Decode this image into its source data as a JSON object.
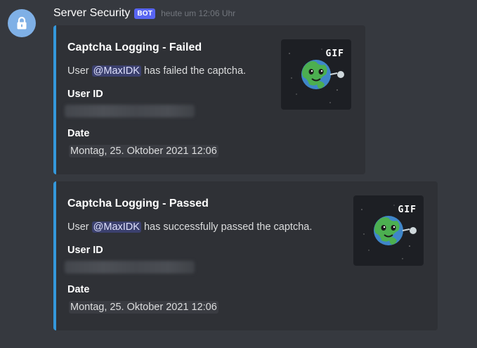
{
  "message": {
    "avatar_icon": "lock-icon",
    "username": "Server Security",
    "bot_tag": "BOT",
    "timestamp": "heute um 12:06 Uhr"
  },
  "embeds": [
    {
      "title": "Captcha Logging - Failed",
      "desc_prefix": "User ",
      "mention": "@MaxIDK",
      "desc_suffix": " has failed the captcha.",
      "fields": [
        {
          "name": "User ID",
          "value_redacted": true
        },
        {
          "name": "Date",
          "value": "Montag, 25. Oktober 2021 12:06"
        }
      ],
      "thumbnail_badge": "GIF",
      "accent_color": "#3498db"
    },
    {
      "title": "Captcha Logging - Passed",
      "desc_prefix": "User ",
      "mention": "@MaxIDK",
      "desc_suffix": " has successfully passed the captcha.",
      "fields": [
        {
          "name": "User ID",
          "value_redacted": true
        },
        {
          "name": "Date",
          "value": "Montag, 25. Oktober 2021 12:06"
        }
      ],
      "thumbnail_badge": "GIF",
      "accent_color": "#3498db"
    }
  ],
  "colors": {
    "background": "#36393f",
    "embed_background": "#2f3136",
    "bot_tag": "#5865f2",
    "avatar": "#7fb0e6"
  }
}
